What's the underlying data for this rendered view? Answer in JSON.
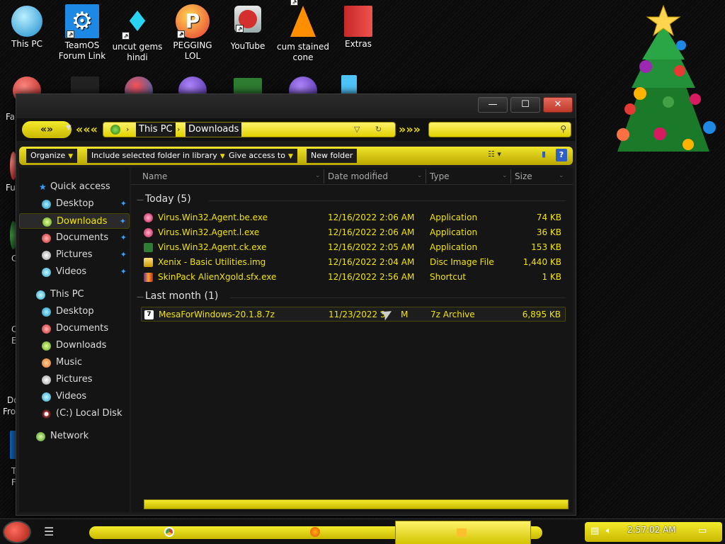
{
  "desktop": {
    "icons": [
      {
        "label": "This PC"
      },
      {
        "label": "TeamOS Forum Link"
      },
      {
        "label": "uncut gems hindi"
      },
      {
        "label": "PEGGING LOL"
      },
      {
        "label": "YouTube"
      },
      {
        "label": "cum stained cone"
      },
      {
        "label": "Extras"
      }
    ],
    "edge_labels": [
      "Fal",
      "Fu",
      "C",
      "C",
      "E",
      "Do",
      "Fro",
      "T",
      "F"
    ]
  },
  "window": {
    "buttons": {
      "minimize": "—",
      "maximize": "☐",
      "close": "✕"
    },
    "address": {
      "crumbs": [
        "This PC",
        "Downloads"
      ]
    },
    "toolbar": {
      "organize": "Organize",
      "include": "Include selected folder in library",
      "give_access": "Give access to",
      "new_folder": "New folder",
      "help": "?"
    },
    "nav_pane": {
      "quick_access": "Quick access",
      "quick_items": [
        "Desktop",
        "Downloads",
        "Documents",
        "Pictures",
        "Videos"
      ],
      "this_pc": "This PC",
      "pc_items": [
        "Desktop",
        "Documents",
        "Downloads",
        "Music",
        "Pictures",
        "Videos",
        "(C:) Local Disk"
      ],
      "network": "Network"
    },
    "columns": {
      "name": "Name",
      "date": "Date modified",
      "type": "Type",
      "size": "Size"
    },
    "groups": {
      "today": "Today (5)",
      "last_month": "Last month (1)"
    },
    "files_today": [
      {
        "name": "Virus.Win32.Agent.be.exe",
        "date": "12/16/2022 2:06 AM",
        "type": "Application",
        "size": "74 KB",
        "icon": "exe-icon"
      },
      {
        "name": "Virus.Win32.Agent.l.exe",
        "date": "12/16/2022 2:06 AM",
        "type": "Application",
        "size": "36 KB",
        "icon": "exe-icon"
      },
      {
        "name": "Virus.Win32.Agent.ck.exe",
        "date": "12/16/2022 2:05 AM",
        "type": "Application",
        "size": "153 KB",
        "icon": "exe-icon"
      },
      {
        "name": "Xenix - Basic Utilities.img",
        "date": "12/16/2022 2:04 AM",
        "type": "Disc Image File",
        "size": "1,440 KB",
        "icon": "disc-image-icon"
      },
      {
        "name": "SkinPack AlienXgold.sfx.exe",
        "date": "12/16/2022 2:56 AM",
        "type": "Shortcut",
        "size": "1 KB",
        "icon": "archive-icon"
      }
    ],
    "files_last_month": [
      {
        "name": "MesaForWindows-20.1.8.7z",
        "date": "11/23/2022 3:",
        "date_suffix": "M",
        "type": "7z Archive",
        "size": "6,895 KB",
        "icon": "7z-icon"
      }
    ]
  },
  "taskbar": {
    "clock": "2:57:02 AM"
  },
  "colors": {
    "accent_yellow": "#f2e500",
    "window_bg": "#1b1b1b",
    "close_red": "#c0392b"
  }
}
